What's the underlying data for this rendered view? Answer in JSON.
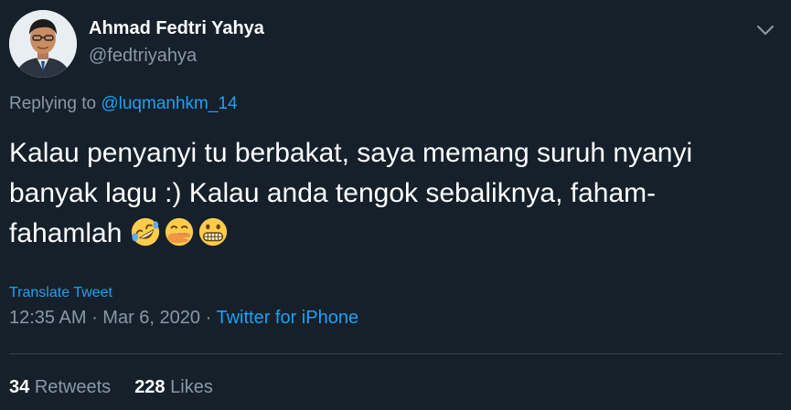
{
  "author": {
    "name": "Ahmad Fedtri Yahya",
    "handle": "@fedtriyahya"
  },
  "reply": {
    "prefix": "Replying to ",
    "mention": "@luqmanhkm_14"
  },
  "tweet": {
    "text": "Kalau penyanyi tu berbakat, saya memang suruh nyanyi banyak lagu :) Kalau anda tengok sebaliknya, faham-fahamlah ",
    "emojis": [
      "rolling-on-floor-laughing-icon",
      "face-with-hand-over-mouth-icon",
      "grimacing-face-icon"
    ]
  },
  "translate_label": "Translate Tweet",
  "meta": {
    "time": "12:35 AM",
    "separator": " · ",
    "date": "Mar 6, 2020",
    "source": "Twitter for iPhone"
  },
  "stats": {
    "retweets_count": "34",
    "retweets_label": "Retweets",
    "likes_count": "228",
    "likes_label": "Likes"
  },
  "colors": {
    "background": "#15202b",
    "text": "#ffffff",
    "secondary": "#8899a6",
    "accent": "#1da1f2",
    "divider": "#38444d"
  }
}
